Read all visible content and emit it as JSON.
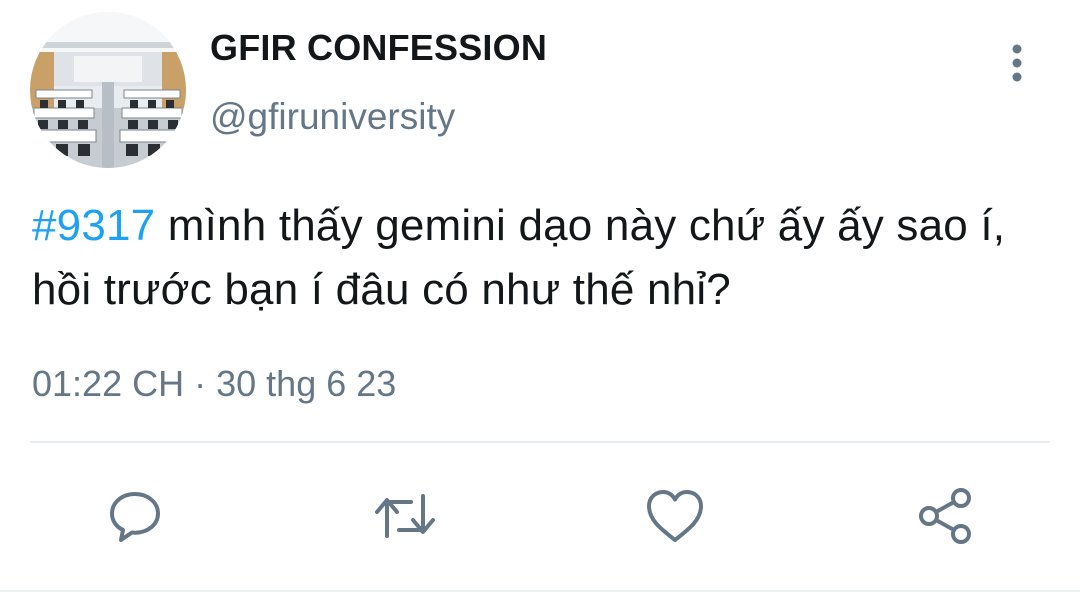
{
  "account": {
    "display_name": "GFIR CONFESSION",
    "handle": "@gfiruniversity"
  },
  "tweet": {
    "hashtag": "#9317",
    "text": " mình thấy gemini dạo này chứ ấy ấy sao í, hồi trước bạn í đâu có như thế nhỉ?",
    "time": "01:22 CH",
    "separator": "·",
    "date": "30 thg 6 23"
  },
  "icons": {
    "more": "more-vertical-icon",
    "reply": "reply-icon",
    "retweet": "retweet-icon",
    "like": "heart-icon",
    "share": "share-icon"
  },
  "colors": {
    "hashtag": "#1da1f2",
    "secondary_text": "#657786",
    "icon": "#657786",
    "divider": "#e6ecf0"
  }
}
